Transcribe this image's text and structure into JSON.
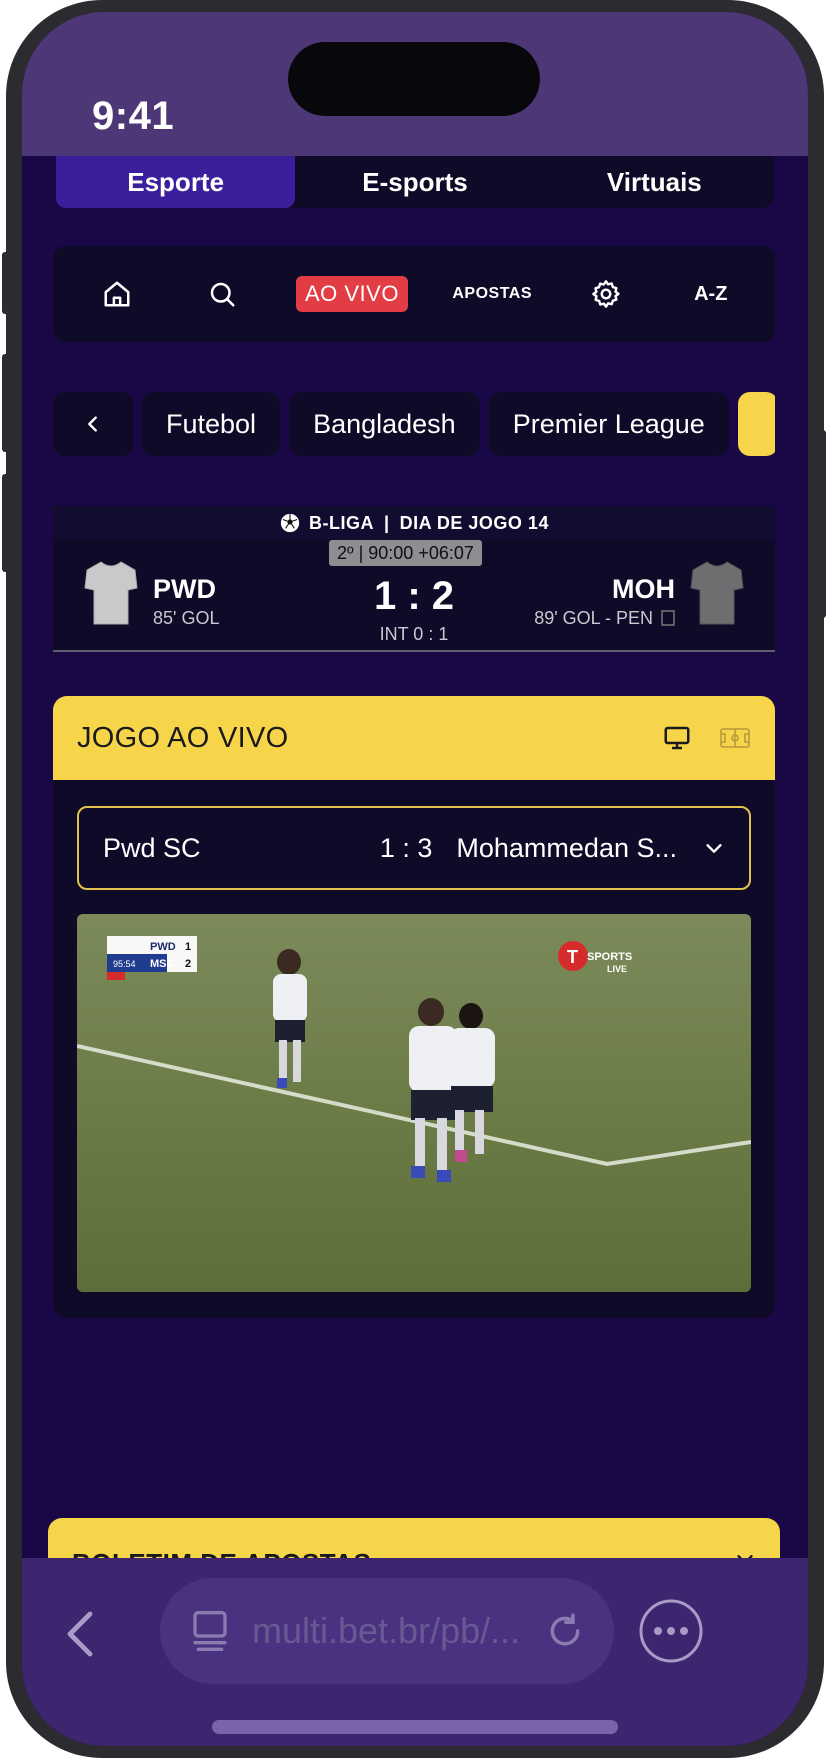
{
  "status": {
    "time": "9:41"
  },
  "tabs": [
    {
      "label": "Esporte",
      "active": true
    },
    {
      "label": "E-sports",
      "active": false
    },
    {
      "label": "Virtuais",
      "active": false
    }
  ],
  "nav": {
    "home_icon": "home-icon",
    "search_icon": "search-icon",
    "live_label": "AO VIVO",
    "bets_label": "APOSTAS",
    "settings_icon": "gear-icon",
    "az_label": "A-Z"
  },
  "breadcrumb": {
    "back_icon": "chevron-left-icon",
    "items": [
      "Futebol",
      "Bangladesh",
      "Premier League"
    ]
  },
  "scoreboard": {
    "league": "B-LIGA",
    "round": "DIA DE JOGO 14",
    "timer": "2º | 90:00 +06:07",
    "home": {
      "name": "PWD",
      "event": "85' GOL"
    },
    "away": {
      "name": "MOH",
      "event": "89' GOL - PEN"
    },
    "score": "1 : 2",
    "halftime": "INT 0 : 1"
  },
  "live": {
    "title": "JOGO AO VIVO",
    "monitor_icon": "monitor-icon",
    "pitch_icon": "pitch-icon",
    "match": {
      "home": "Pwd SC",
      "score": "1 : 3",
      "away": "Mohammedan S..."
    },
    "video": {
      "overlay_home": "PWD",
      "overlay_home_score": "1",
      "overlay_away": "MSC",
      "overlay_away_score": "2",
      "overlay_clock": "95:54",
      "broadcaster_top": "SPORTS",
      "broadcaster_bottom": "LIVE"
    }
  },
  "betslip": {
    "title": "BOLETIM DE APOSTAS"
  },
  "browser": {
    "url": "multi.bet.br/pb/..."
  },
  "colors": {
    "accent_yellow": "#f7d54b",
    "active_tab": "#3b1e9c",
    "live_red": "#e23d45",
    "background": "#1a0746"
  }
}
